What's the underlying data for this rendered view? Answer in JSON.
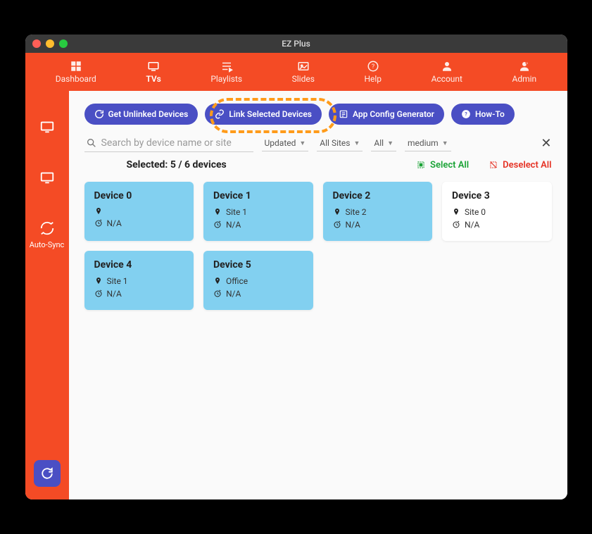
{
  "window": {
    "title": "EZ Plus"
  },
  "nav": [
    {
      "label": "Dashboard",
      "icon": "dashboard"
    },
    {
      "label": "TVs",
      "icon": "tv",
      "active": true
    },
    {
      "label": "Playlists",
      "icon": "playlist"
    },
    {
      "label": "Slides",
      "icon": "slides"
    },
    {
      "label": "Help",
      "icon": "help"
    },
    {
      "label": "Account",
      "icon": "account"
    },
    {
      "label": "Admin",
      "icon": "admin"
    }
  ],
  "sidebar": {
    "items": [
      {
        "icon": "tv-outline",
        "label": ""
      },
      {
        "icon": "tv-outline2",
        "label": ""
      },
      {
        "icon": "sync",
        "label": "Auto-Sync"
      }
    ]
  },
  "actions": {
    "get_unlinked": "Get Unlinked Devices",
    "link_selected": "Link Selected Devices",
    "config_gen": "App Config Generator",
    "howto": "How-To"
  },
  "search": {
    "placeholder": "Search by device name or site"
  },
  "filters": {
    "sort": "Updated",
    "site": "All Sites",
    "status": "All",
    "size": "medium"
  },
  "selection": {
    "label": "Selected: 5 / 6 devices",
    "select_all": "Select All",
    "deselect_all": "Deselect All"
  },
  "devices": [
    {
      "name": "Device 0",
      "site": "",
      "sync": "N/A",
      "selected": true
    },
    {
      "name": "Device 1",
      "site": "Site 1",
      "sync": "N/A",
      "selected": true
    },
    {
      "name": "Device 2",
      "site": "Site 2",
      "sync": "N/A",
      "selected": true
    },
    {
      "name": "Device 3",
      "site": "Site 0",
      "sync": "N/A",
      "selected": false
    },
    {
      "name": "Device 4",
      "site": "Site 1",
      "sync": "N/A",
      "selected": true
    },
    {
      "name": "Device 5",
      "site": "Office",
      "sync": "N/A",
      "selected": true
    }
  ]
}
